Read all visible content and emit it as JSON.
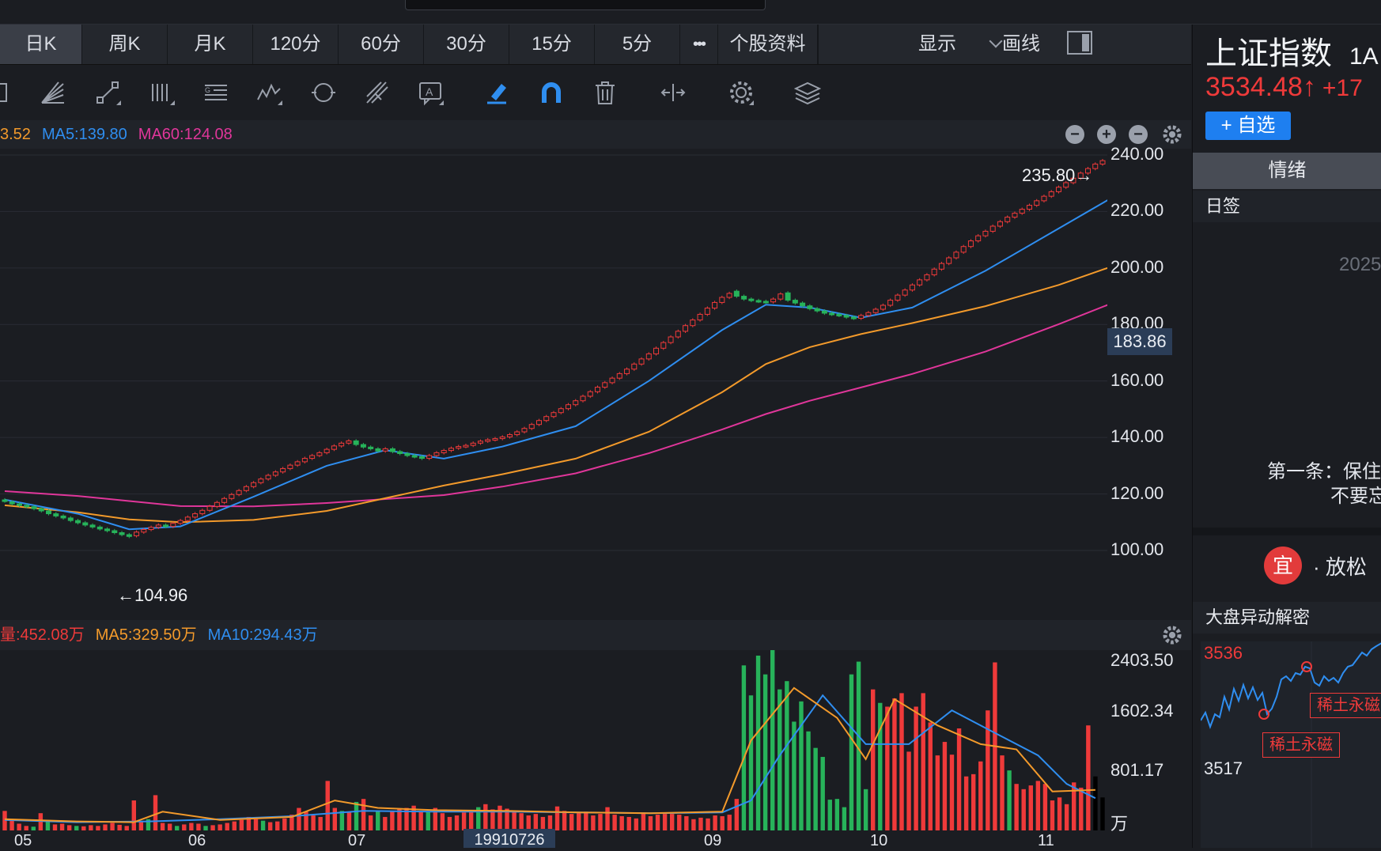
{
  "tabs": [
    "日K",
    "周K",
    "月K",
    "120分",
    "60分",
    "30分",
    "15分",
    "5分",
    "•••",
    "个股资料"
  ],
  "tab_active": 0,
  "header_right": {
    "display": "显示",
    "draw": "画线"
  },
  "toolbar_icons": [
    "select-icon",
    "fan-lines-icon",
    "segment-icon",
    "parallel-lines-icon",
    "fibonacci-icon",
    "wave-icon",
    "cycle-icon",
    "pitchfork-icon",
    "text-annotation-icon",
    "highlighter-icon",
    "magnet-icon",
    "trash-icon",
    "fit-width-icon",
    "settings-icon",
    "layers-icon"
  ],
  "legend_main": {
    "ma_prefix": "3.52",
    "ma5": "MA5:139.80",
    "ma60": "MA60:124.08"
  },
  "legend_volume": {
    "vol": "量:452.08万",
    "ma5": "MA5:329.50万",
    "ma10": "MA10:294.43万"
  },
  "price_axis": [
    "240.00",
    "220.00",
    "200.00",
    "180.00",
    "160.00",
    "140.00",
    "120.00",
    "100.00"
  ],
  "current_price_tag": "183.86",
  "volume_axis": [
    "2403.50",
    "1602.34",
    "801.17",
    "万"
  ],
  "x_axis": [
    "05",
    "06",
    "07",
    "09",
    "10",
    "11"
  ],
  "date_tag": "19910726",
  "annotations": {
    "high": "235.80→",
    "low": "←104.96"
  },
  "sidebar": {
    "title": "上证指数",
    "title_suffix": "1A",
    "price": "3534.48↑",
    "change": "+17",
    "add_button": "+ 自选",
    "tab": "情绪",
    "day_sign": "日签",
    "year": "2025",
    "rule_line1": "第一条：保住",
    "rule_line2": "不要忘",
    "yi": "宜",
    "relax": "· 放松",
    "dapan": "大盘异动解密",
    "mini_high": "3536",
    "mini_low": "3517",
    "mini_tag1": "稀土永磁",
    "mini_tag2": "稀土永磁"
  },
  "colors": {
    "up": "#ef3a3a",
    "down": "#27b35a",
    "ma5": "#2f8ef0",
    "ma10": "#f39a2b",
    "ma60": "#e0369a"
  },
  "chart_data": [
    {
      "type": "candlestick",
      "ylim": [
        100,
        240
      ],
      "x_ticks": [
        "05",
        "06",
        "07",
        "09",
        "10",
        "11"
      ],
      "close": [
        117.5,
        116.5,
        116,
        115.5,
        114.8,
        114,
        113,
        112.2,
        111.5,
        110.6,
        109.8,
        109,
        108.3,
        107.6,
        107,
        106.3,
        105.6,
        104.96,
        106.5,
        107.4,
        108.2,
        109,
        108.5,
        109.6,
        110.6,
        111.8,
        113,
        114.2,
        115.6,
        117,
        118.4,
        119.8,
        121.2,
        122.6,
        124,
        125.3,
        126.6,
        127.8,
        129,
        130.2,
        131.4,
        132.6,
        133.6,
        134.6,
        135.8,
        137,
        138,
        138.8,
        137.5,
        136.6,
        136,
        135.2,
        136,
        135,
        134.3,
        133.6,
        133.2,
        132.6,
        133.6,
        134.6,
        135.4,
        136.2,
        136.8,
        137.2,
        138,
        138.7,
        139.2,
        139.6,
        140.2,
        141,
        142,
        143.2,
        144.6,
        146,
        147.4,
        148.8,
        150.2,
        151.6,
        153,
        154.6,
        156.2,
        157.8,
        159.4,
        161,
        162.6,
        164.2,
        166,
        167.8,
        169.6,
        171.6,
        173.6,
        175.6,
        177.6,
        179.6,
        181.6,
        183.6,
        185.8,
        187.8,
        189.6,
        191,
        190,
        189,
        188.5,
        188.2,
        188,
        189,
        190.8,
        188.6,
        187.6,
        186.6,
        185.6,
        184.8,
        184,
        183.6,
        183.2,
        182.6,
        182.2,
        183.2,
        184.2,
        185.4,
        186.8,
        188.6,
        190.4,
        192.2,
        194,
        195.8,
        197.6,
        199.6,
        201.6,
        203.6,
        205.6,
        207.6,
        209.6,
        211.4,
        213,
        214.8,
        216.4,
        218,
        219.4,
        220.8,
        222.2,
        223.8,
        225.4,
        227,
        228.6,
        230.2,
        231.8,
        233.6,
        235.2,
        236.8,
        238
      ],
      "open": [
        117.9,
        117.2,
        116.5,
        116,
        115.5,
        114.8,
        114,
        113,
        112.2,
        111.5,
        110.6,
        109.8,
        109,
        108.3,
        107.6,
        107,
        106.3,
        105.6,
        105.2,
        106.5,
        107.4,
        108.2,
        109,
        108.5,
        109.6,
        110.6,
        111.8,
        113,
        114.2,
        115.6,
        117,
        118.4,
        119.8,
        121.2,
        122.6,
        124,
        125.3,
        126.6,
        127.8,
        129,
        130.2,
        131.4,
        132.6,
        133.6,
        134.6,
        135.8,
        137,
        138,
        138.8,
        137.5,
        136.6,
        136,
        135.2,
        136,
        135,
        134.3,
        133.6,
        133.2,
        132.6,
        133.6,
        134.6,
        135.4,
        136.2,
        136.8,
        137.2,
        138,
        138.7,
        139.2,
        139.6,
        140.2,
        141,
        142,
        143.2,
        144.6,
        146,
        147.4,
        148.8,
        150.2,
        151.6,
        153,
        154.6,
        156.2,
        157.8,
        159.4,
        161,
        162.6,
        164.2,
        166,
        167.8,
        169.6,
        171.6,
        173.6,
        175.6,
        177.6,
        179.6,
        181.6,
        183.6,
        185.8,
        187.8,
        189.6,
        191.8,
        190,
        189,
        188.5,
        188.2,
        188,
        189,
        191.2,
        188.6,
        187.6,
        186.6,
        185.6,
        184.8,
        184,
        183.6,
        183.2,
        182.6,
        182.2,
        183.2,
        184.2,
        185.4,
        186.8,
        188.6,
        190.4,
        192.2,
        194,
        195.8,
        197.6,
        199.6,
        201.6,
        203.6,
        205.6,
        207.6,
        209.6,
        211.4,
        213,
        214.8,
        216.4,
        218,
        219.4,
        220.8,
        222.2,
        223.8,
        225.4,
        227,
        228.6,
        230.2,
        231.8,
        233.6,
        235.2,
        236.8
      ],
      "ma_lines": {
        "MA5": [
          [
            0,
            118
          ],
          [
            10,
            113
          ],
          [
            17,
            107.5
          ],
          [
            24,
            108.5
          ],
          [
            34,
            119
          ],
          [
            44,
            130
          ],
          [
            52,
            135.5
          ],
          [
            60,
            132.5
          ],
          [
            68,
            136.8
          ],
          [
            78,
            144
          ],
          [
            88,
            160
          ],
          [
            98,
            178
          ],
          [
            104,
            187
          ],
          [
            110,
            186
          ],
          [
            117,
            182.4
          ],
          [
            124,
            186
          ],
          [
            134,
            199
          ],
          [
            144,
            214
          ],
          [
            154,
            229
          ]
        ],
        "MA10": [
          [
            0,
            116
          ],
          [
            10,
            113.5
          ],
          [
            17,
            111
          ],
          [
            24,
            110
          ],
          [
            34,
            110.8
          ],
          [
            44,
            114
          ],
          [
            52,
            118.5
          ],
          [
            60,
            123
          ],
          [
            68,
            127
          ],
          [
            78,
            132.5
          ],
          [
            88,
            142
          ],
          [
            98,
            156
          ],
          [
            104,
            166
          ],
          [
            110,
            172
          ],
          [
            117,
            176.6
          ],
          [
            124,
            180.5
          ],
          [
            134,
            186.5
          ],
          [
            144,
            194
          ],
          [
            154,
            203
          ]
        ],
        "MA60": [
          [
            0,
            121
          ],
          [
            10,
            119.3
          ],
          [
            17,
            117.5
          ],
          [
            24,
            115.7
          ],
          [
            34,
            115.6
          ],
          [
            44,
            116.8
          ],
          [
            52,
            118.2
          ],
          [
            60,
            119.6
          ],
          [
            68,
            122.6
          ],
          [
            78,
            127.3
          ],
          [
            88,
            134.4
          ],
          [
            98,
            142.8
          ],
          [
            104,
            148.3
          ],
          [
            110,
            153
          ],
          [
            117,
            157.7
          ],
          [
            124,
            162.5
          ],
          [
            134,
            170.4
          ],
          [
            144,
            180.1
          ],
          [
            154,
            190.3
          ]
        ]
      },
      "annotations": {
        "max": 235.8,
        "min": 104.96
      }
    },
    {
      "type": "bar",
      "ylim": [
        0,
        2403.5
      ],
      "unit": "万",
      "values": [
        260,
        150,
        90,
        60,
        50,
        230,
        120,
        80,
        90,
        70,
        60,
        55,
        70,
        60,
        80,
        100,
        75,
        60,
        400,
        120,
        150,
        470,
        100,
        90,
        60,
        80,
        100,
        90,
        60,
        70,
        80,
        100,
        120,
        140,
        180,
        150,
        130,
        110,
        120,
        160,
        210,
        300,
        250,
        200,
        180,
        660,
        300,
        260,
        250,
        380,
        420,
        200,
        260,
        180,
        250,
        280,
        300,
        330,
        260,
        250,
        300,
        230,
        180,
        200,
        240,
        260,
        310,
        350,
        280,
        330,
        290,
        250,
        230,
        200,
        220,
        180,
        200,
        320,
        260,
        220,
        230,
        250,
        200,
        220,
        310,
        210,
        190,
        180,
        160,
        240,
        190,
        210,
        220,
        220,
        210,
        190,
        150,
        170,
        160,
        200,
        190,
        210,
        420,
        2200,
        1800,
        2330,
        2080,
        2440,
        1880,
        1990,
        1450,
        1720,
        1320,
        1100,
        980,
        410,
        420,
        310,
        2080,
        2250,
        550,
        1880,
        1700,
        1650,
        1760,
        1830,
        1050,
        1650,
        1830,
        1440,
        1000,
        1180,
        1010,
        1360,
        720,
        750,
        920,
        1600,
        2240,
        1000,
        800,
        620,
        550,
        600,
        660,
        620,
        400,
        440,
        350,
        640,
        570,
        1400,
        720,
        440
      ],
      "colors": [
        "up",
        "up",
        "up",
        "up",
        "down",
        "up",
        "down",
        "up",
        "up",
        "up",
        "down",
        "up",
        "up",
        "up",
        "up",
        "up",
        "up",
        "up",
        "up",
        "up",
        "down",
        "up",
        "up",
        "up",
        "down",
        "up",
        "up",
        "up",
        "down",
        "up",
        "up",
        "up",
        "up",
        "up",
        "up",
        "up",
        "down",
        "up",
        "up",
        "up",
        "up",
        "up",
        "up",
        "up",
        "up",
        "up",
        "up",
        "down",
        "up",
        "down",
        "up",
        "up",
        "down",
        "up",
        "up",
        "up",
        "up",
        "up",
        "up",
        "down",
        "up",
        "up",
        "up",
        "up",
        "up",
        "up",
        "down",
        "up",
        "up",
        "up",
        "up",
        "up",
        "up",
        "up",
        "up",
        "up",
        "up",
        "up",
        "up",
        "up",
        "up",
        "up",
        "up",
        "up",
        "up",
        "up",
        "up",
        "up",
        "up",
        "up",
        "up",
        "up",
        "up",
        "up",
        "up",
        "up",
        "up",
        "up",
        "up",
        "up",
        "up",
        "up",
        "up",
        "down",
        "down",
        "down",
        "down",
        "down",
        "down",
        "down",
        "down",
        "down",
        "down",
        "down",
        "down",
        "down",
        "down",
        "down",
        "down",
        "down",
        "down",
        "up",
        "down",
        "up",
        "up",
        "up",
        "up",
        "up",
        "up",
        "up",
        "up",
        "up",
        "up",
        "up",
        "up",
        "up",
        "up",
        "up",
        "up",
        "up",
        "down",
        "up",
        "up",
        "up",
        "up",
        "up",
        "up",
        "up",
        "up",
        "up",
        "up",
        "up"
      ],
      "ma_lines": {
        "MA5": [
          [
            0,
            150
          ],
          [
            10,
            120
          ],
          [
            18,
            110
          ],
          [
            22,
            250
          ],
          [
            30,
            140
          ],
          [
            40,
            180
          ],
          [
            46,
            400
          ],
          [
            52,
            300
          ],
          [
            60,
            270
          ],
          [
            70,
            260
          ],
          [
            80,
            240
          ],
          [
            90,
            230
          ],
          [
            100,
            250
          ],
          [
            104,
            1200
          ],
          [
            110,
            1900
          ],
          [
            116,
            1500
          ],
          [
            120,
            950
          ],
          [
            124,
            1750
          ],
          [
            130,
            1400
          ],
          [
            136,
            1150
          ],
          [
            141,
            1080
          ],
          [
            146,
            520
          ],
          [
            152,
            540
          ]
        ],
        "MA10": [
          [
            0,
            140
          ],
          [
            10,
            110
          ],
          [
            20,
            120
          ],
          [
            30,
            150
          ],
          [
            40,
            190
          ],
          [
            50,
            260
          ],
          [
            60,
            250
          ],
          [
            70,
            250
          ],
          [
            80,
            240
          ],
          [
            90,
            230
          ],
          [
            100,
            240
          ],
          [
            104,
            400
          ],
          [
            108,
            1000
          ],
          [
            114,
            1800
          ],
          [
            120,
            1150
          ],
          [
            126,
            1150
          ],
          [
            132,
            1600
          ],
          [
            138,
            1300
          ],
          [
            144,
            1000
          ],
          [
            148,
            620
          ],
          [
            152,
            430
          ]
        ]
      }
    }
  ]
}
